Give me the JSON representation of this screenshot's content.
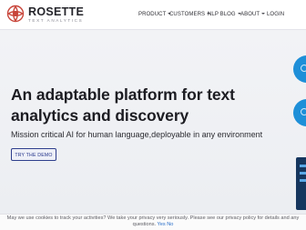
{
  "header": {
    "logo_name": "ROSETTE",
    "logo_tagline": "TEXT ANALYTICS",
    "nav": [
      {
        "label": "PRODUCT",
        "has_dropdown": true
      },
      {
        "label": "CUSTOMERS",
        "has_dropdown": true
      },
      {
        "label": "NLP BLOG",
        "has_dropdown": true
      },
      {
        "label": "ABOUT",
        "has_dropdown": true
      },
      {
        "label": "LOGIN",
        "has_dropdown": false
      }
    ]
  },
  "hero": {
    "title": "An adaptable platform for text analytics and discovery",
    "subtitle": "Mission critical AI for human language,deployable in any environment",
    "cta_label": "TRY THE DEMO"
  },
  "cookie_banner": {
    "text": "May we use cookies to track your activities? We take your privacy very seriously. Please see our privacy policy for details and any",
    "text_end": "questions.",
    "yes_label": "Yes",
    "no_label": "No"
  },
  "colors": {
    "accent": "#2e3e8c",
    "logo_red": "#c8453a",
    "side_blue": "#1e8fd8",
    "hero_bg": "#eff1f4"
  },
  "icons": {
    "logo": "rosette-flower-icon",
    "dropdown": "chevron-down-icon"
  }
}
